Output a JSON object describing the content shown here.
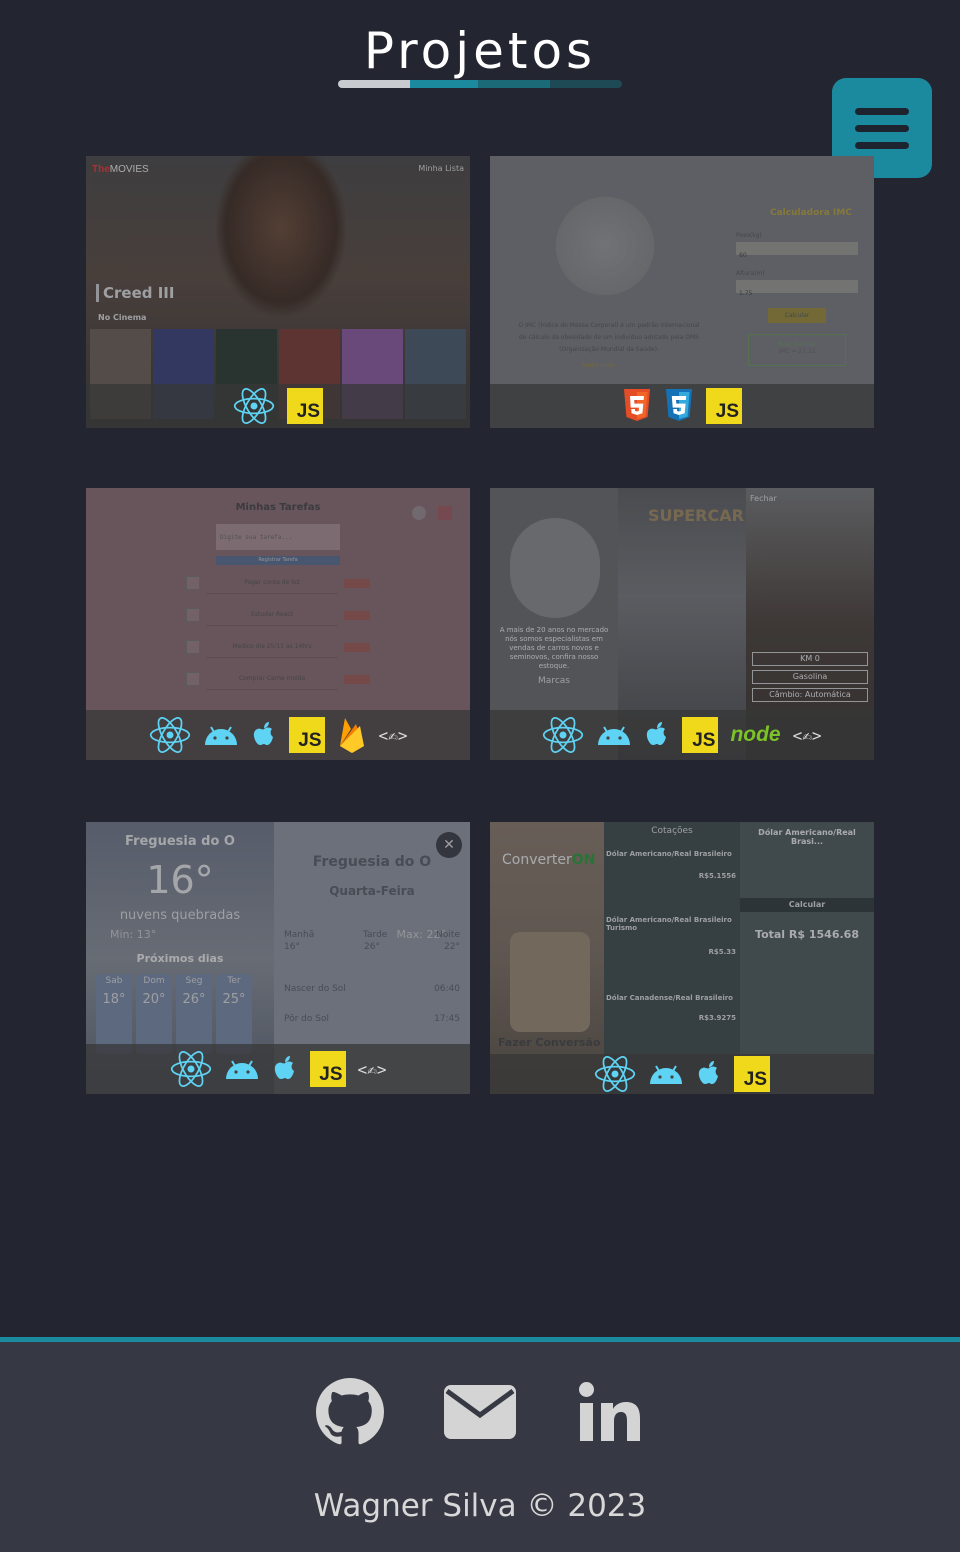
{
  "header": {
    "title": "Projetos",
    "underline_colors": [
      "#c8ccd0",
      "#1b8a9e",
      "#1b6a78",
      "#1d4a55"
    ]
  },
  "colors": {
    "background": "#232530",
    "accent": "#1b8a9e",
    "footer": "#363843"
  },
  "projects": [
    {
      "name": "movies",
      "screen": {
        "brand_red": "The",
        "brand": "MOVIES",
        "menu": "Minha Lista",
        "title": "Creed III",
        "section": "No Cinema"
      },
      "tech": [
        "react-icon",
        "javascript-icon"
      ]
    },
    {
      "name": "imc-calculator",
      "screen": {
        "title": "Calculadora IMC",
        "peso_label": "Peso(kg)",
        "peso_value": "60",
        "altura_label": "Altura(m)",
        "altura_value": "1.75",
        "button": "Calcular",
        "result_label": "Peso Normal",
        "result_value": "IMC = 21.22",
        "description": "O IMC (Índice de Massa Corporal) é um padrão internacional de cálculo da obesidade de um indivíduo adotado pela OMS (Organização Mundial da Saúde).",
        "link": "Saiba mais"
      },
      "tech": [
        "html5-icon",
        "css3-icon",
        "javascript-icon"
      ]
    },
    {
      "name": "todo-list",
      "screen": {
        "title": "Minhas Tarefas",
        "placeholder": "Digite sua tarefa...",
        "button": "Registrar Tarefa",
        "items": [
          "Pagar conta de luz",
          "Estudar React",
          "Medico dia 25/11 as 14hrs",
          "Comprar Carne moida"
        ]
      },
      "tech": [
        "react-icon",
        "android-icon",
        "apple-icon",
        "javascript-icon",
        "firebase-icon",
        "expo-icon"
      ]
    },
    {
      "name": "supercar",
      "screen": {
        "brand": "SUPERCAR",
        "close": "Fechar",
        "description": "A mais de 20 anos no mercado nós somos especialistas em vendas de carros novos e seminovos, confira nosso estoque.",
        "section": "Marcas",
        "km": "KM  0",
        "fuel": "Gasolina",
        "gear": "Câmbio: Automática"
      },
      "tech": [
        "react-icon",
        "android-icon",
        "apple-icon",
        "javascript-icon",
        "nodejs-icon",
        "expo-icon"
      ]
    },
    {
      "name": "weather",
      "screen": {
        "city": "Freguesia do O",
        "temp": "16°",
        "desc": "nuvens quebradas",
        "min": "Min: 13°",
        "max": "Max: 22°",
        "next": "Próximos dias",
        "days": [
          "Sab",
          "Dom",
          "Seg",
          "Ter"
        ],
        "temps": [
          "18°",
          "20°",
          "26°",
          "25°"
        ],
        "weekday": "Quarta-Feira",
        "periods": [
          "Manhã",
          "Tarde",
          "Noite"
        ],
        "period_temps": [
          "16°",
          "26°",
          "22°"
        ],
        "sunrise_label": "Nascer do Sol",
        "sunrise": "06:40",
        "sunset_label": "Pôr do Sol",
        "sunset": "17:45"
      },
      "tech": [
        "react-icon",
        "android-icon",
        "apple-icon",
        "javascript-icon",
        "expo-icon"
      ]
    },
    {
      "name": "converter",
      "screen": {
        "brand": "Converter",
        "brand_on": "ON",
        "cta": "Fazer Conversão",
        "quotes_title": "Cotações",
        "quote1": "Dólar Americano/Real Brasileiro",
        "quote1_value": "R$5.1556",
        "quote2": "Dólar Americano/Real Brasileiro Turismo",
        "quote2_value": "R$5.33",
        "quote3": "Dólar Canadense/Real Brasileiro",
        "quote3_value": "R$3.9275",
        "right_title": "Dólar Americano/Real Brasi...",
        "calc": "Calcular",
        "total": "Total R$ 1546.68"
      },
      "tech": [
        "react-icon",
        "android-icon",
        "apple-icon",
        "javascript-icon"
      ]
    }
  ],
  "footer": {
    "links": [
      "github-icon",
      "email-icon",
      "linkedin-icon"
    ],
    "copyright": "Wagner Silva © 2023"
  }
}
